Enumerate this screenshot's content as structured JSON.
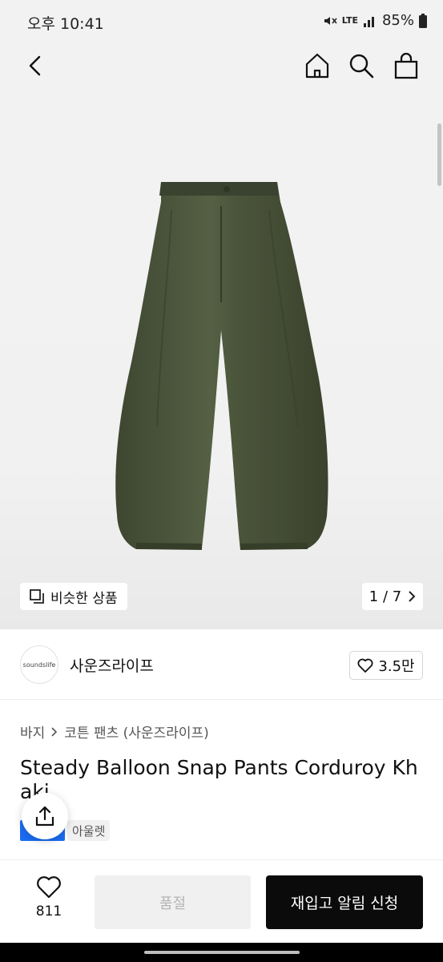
{
  "status": {
    "time": "오후 10:41",
    "network": "LTE",
    "battery": "85%"
  },
  "header": {
    "back_icon": "chevron-left-icon",
    "home_icon": "home-icon",
    "search_icon": "search-icon",
    "bag_icon": "shopping-bag-icon"
  },
  "gallery": {
    "similar_label": "비슷한 상품",
    "pager": "1 / 7",
    "pants_color": "#4a5238"
  },
  "brand": {
    "logo_text": "soundslife",
    "name": "사운즈라이프",
    "likes": "3.5만"
  },
  "breadcrumb": {
    "category": "바지",
    "subcategory": "코튼 팬츠 (사운즈라이프)"
  },
  "product": {
    "title_line1": "Steady Balloon Snap Pants Corduroy Kh",
    "title_line2": "aki",
    "tag": "아울렛",
    "tag_color": "#1b6cf2"
  },
  "bottom": {
    "wish_count": "811",
    "soldout_label": "품절",
    "restock_label": "재입고 알림 신청"
  }
}
